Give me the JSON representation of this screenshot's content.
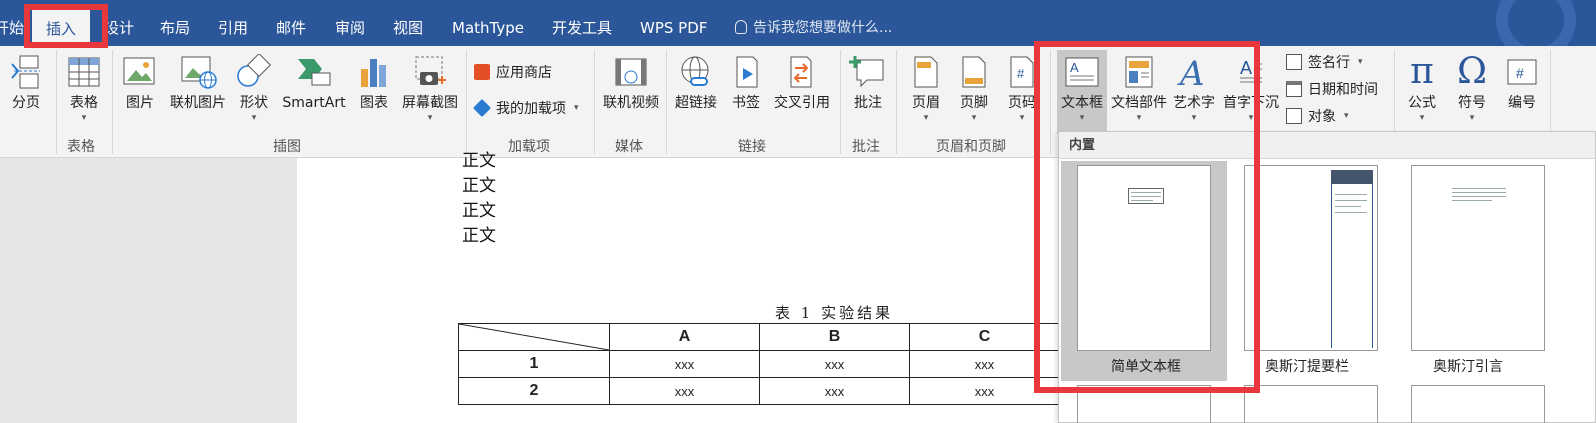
{
  "tabs": [
    "开始",
    "插入",
    "设计",
    "布局",
    "引用",
    "邮件",
    "审阅",
    "视图",
    "MathType",
    "开发工具",
    "WPS PDF"
  ],
  "tell_me": "告诉我您想要做什么...",
  "ribbon": {
    "commands": {
      "page_break": "分页",
      "table": "表格",
      "picture": "图片",
      "online_picture": "联机图片",
      "shapes": "形状",
      "smartart": "SmartArt",
      "chart": "图表",
      "screenshot": "屏幕截图",
      "store": "应用商店",
      "my_addins": "我的加载项",
      "online_video": "联机视频",
      "hyperlink": "超链接",
      "bookmark": "书签",
      "cross_ref": "交叉引用",
      "comment": "批注",
      "header": "页眉",
      "footer": "页脚",
      "page_number": "页码",
      "textbox": "文本框",
      "quick_parts": "文档部件",
      "wordart": "艺术字",
      "dropcap": "首字下沉",
      "signature": "签名行",
      "datetime": "日期和时间",
      "object": "对象",
      "equation": "公式",
      "symbol": "符号",
      "number": "编号"
    },
    "groups": {
      "tables": "表格",
      "illustrations": "插图",
      "addins": "加载项",
      "media": "媒体",
      "links": "链接",
      "comments": "批注",
      "header_footer": "页眉和页脚"
    }
  },
  "document": {
    "paragraphs": [
      "正文",
      "正文",
      "正文",
      "正文"
    ],
    "table_caption": "表 1 实验结果",
    "table": {
      "columns": [
        "A",
        "B",
        "C"
      ],
      "rows": [
        {
          "label": "1",
          "cells": [
            "xxx",
            "xxx",
            "xxx"
          ]
        },
        {
          "label": "2",
          "cells": [
            "xxx",
            "xxx",
            "xxx"
          ]
        }
      ]
    }
  },
  "gallery": {
    "header": "内置",
    "items": [
      "简单文本框",
      "奥斯汀提要栏",
      "奥斯汀引言"
    ]
  },
  "colors": {
    "title_bar": "#2b579a",
    "annotation_red": "#e8383d",
    "ribbon_bg": "#f3f3f3"
  }
}
